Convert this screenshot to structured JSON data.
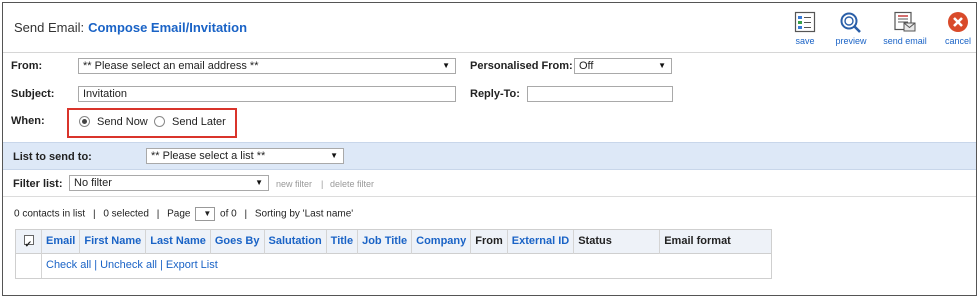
{
  "header": {
    "title": "Send Email:",
    "subtitle": "Compose Email/Invitation",
    "toolbar": {
      "save": "save",
      "preview": "preview",
      "send_email": "send email",
      "cancel": "cancel"
    }
  },
  "form": {
    "from_label": "From:",
    "from_value": "** Please select an email address **",
    "personalised_label": "Personalised From:",
    "personalised_value": "Off",
    "subject_label": "Subject:",
    "subject_value": "Invitation",
    "reply_to_label": "Reply-To:",
    "reply_to_value": "",
    "when_label": "When:",
    "send_now": "Send Now",
    "send_later": "Send Later",
    "send_now_selected": true
  },
  "list": {
    "label": "List to send to:",
    "value": "** Please select a list **"
  },
  "filter": {
    "label": "Filter list:",
    "value": "No filter",
    "new_filter": "new filter",
    "delete_filter": "delete filter"
  },
  "status": {
    "contacts": "0 contacts in list",
    "selected": "0 selected",
    "page_label": "Page",
    "page_value": "",
    "of_pages": "of 0",
    "sorting": "Sorting by 'Last name'"
  },
  "table": {
    "columns": [
      "Email",
      "First Name",
      "Last Name",
      "Goes By",
      "Salutation",
      "Title",
      "Job Title",
      "Company",
      "From",
      "External ID",
      "Status",
      "Email format"
    ],
    "footer": {
      "check_all": "Check all",
      "uncheck_all": "Uncheck all",
      "export_list": "Export List"
    }
  },
  "colors": {
    "link_blue": "#1a63c6",
    "bar_blue": "#dde8f7",
    "highlight_red": "#d9342b",
    "cancel_red": "#d94a2a"
  }
}
